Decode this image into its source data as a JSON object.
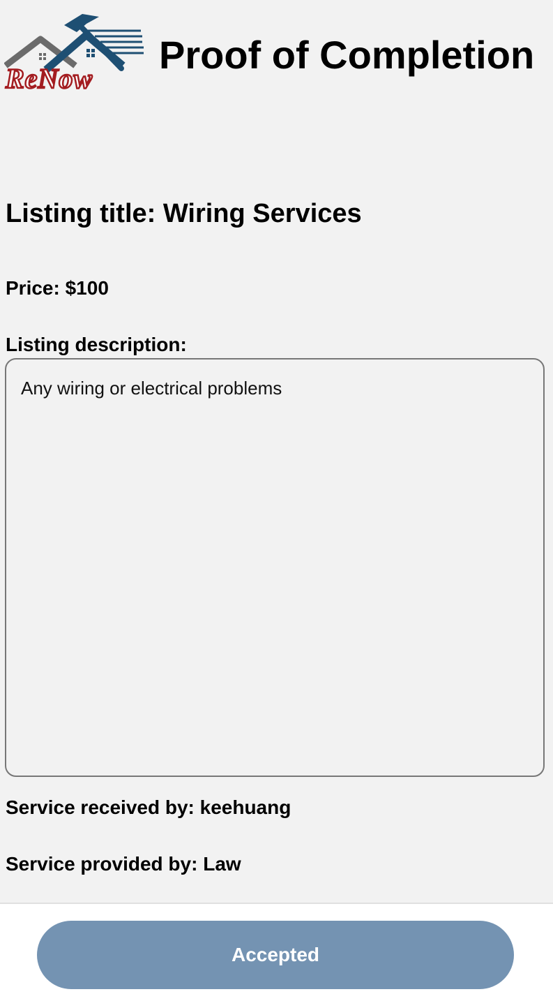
{
  "header": {
    "logo_text": "ReNow",
    "title": "Proof of Completion"
  },
  "listing": {
    "title_label": "Listing title:",
    "title_value": "Wiring Services",
    "price_label": "Price:",
    "price_value": "$100",
    "description_label": "Listing description:",
    "description_value": "Any wiring or electrical problems"
  },
  "service": {
    "received_label": "Service received by:",
    "received_value": "keehuang",
    "provided_label": "Service provided by:",
    "provided_value": "Law"
  },
  "footer": {
    "button_label": "Accepted"
  },
  "colors": {
    "background": "#f2f2f2",
    "button": "#7493b2",
    "logo_red": "#a31c20",
    "logo_blue": "#1e4f73",
    "logo_gray": "#6b6b6b"
  }
}
